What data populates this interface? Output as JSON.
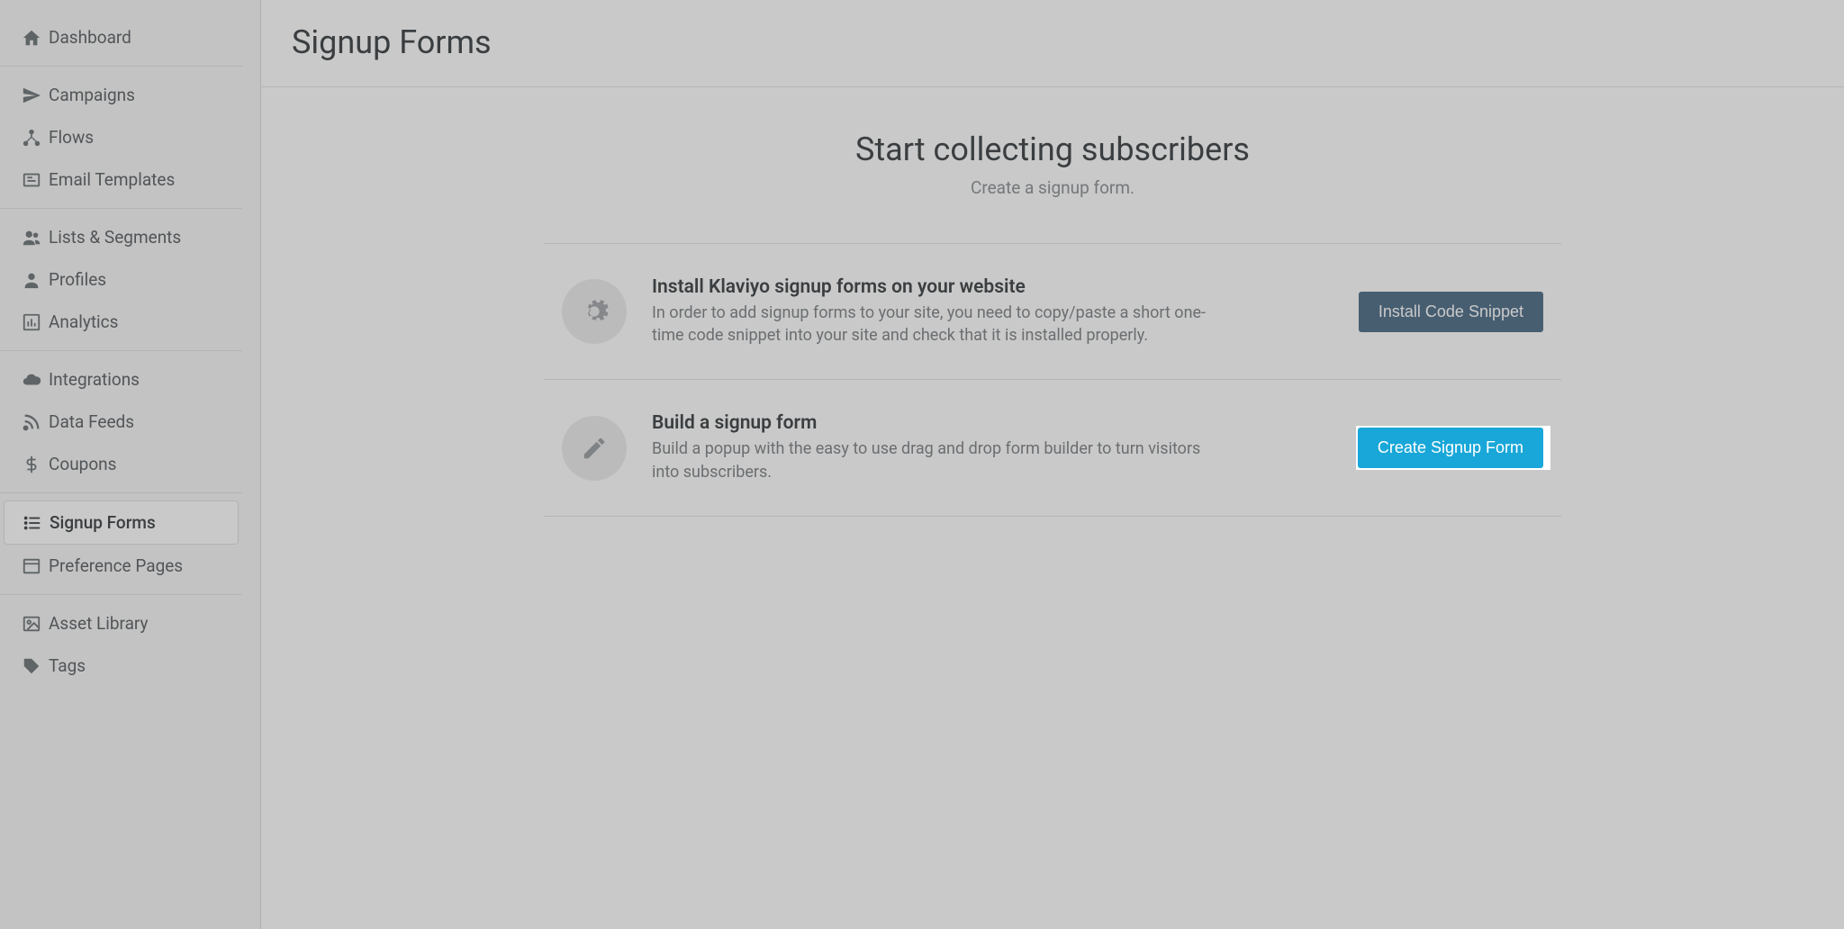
{
  "sidebar": {
    "groups": [
      {
        "items": [
          {
            "icon": "home",
            "label": "Dashboard"
          }
        ]
      },
      {
        "items": [
          {
            "icon": "paper-plane",
            "label": "Campaigns"
          },
          {
            "icon": "sitemap",
            "label": "Flows"
          },
          {
            "icon": "newspaper",
            "label": "Email Templates"
          }
        ]
      },
      {
        "items": [
          {
            "icon": "users",
            "label": "Lists & Segments"
          },
          {
            "icon": "user",
            "label": "Profiles"
          },
          {
            "icon": "bar-chart",
            "label": "Analytics"
          }
        ]
      },
      {
        "items": [
          {
            "icon": "cloud",
            "label": "Integrations"
          },
          {
            "icon": "rss",
            "label": "Data Feeds"
          },
          {
            "icon": "dollar",
            "label": "Coupons"
          }
        ]
      },
      {
        "items": [
          {
            "icon": "list",
            "label": "Signup Forms",
            "active": true
          },
          {
            "icon": "layout",
            "label": "Preference Pages"
          }
        ]
      },
      {
        "items": [
          {
            "icon": "image",
            "label": "Asset Library"
          },
          {
            "icon": "tag",
            "label": "Tags"
          }
        ]
      }
    ]
  },
  "page": {
    "title": "Signup Forms",
    "hero_title": "Start collecting subscribers",
    "hero_subtitle": "Create a signup form."
  },
  "cards": [
    {
      "icon": "gears",
      "title": "Install Klaviyo signup forms on your website",
      "desc": "In order to add signup forms to your site, you need to copy/paste a short one-time code snippet into your site and check that it is installed properly.",
      "button": "Install Code Snippet",
      "button_style": "dark"
    },
    {
      "icon": "pencil",
      "title": "Build a signup form",
      "desc": "Build a popup with the easy to use drag and drop form builder to turn visitors into subscribers.",
      "button": "Create Signup Form",
      "button_style": "primary",
      "highlighted": true
    }
  ]
}
